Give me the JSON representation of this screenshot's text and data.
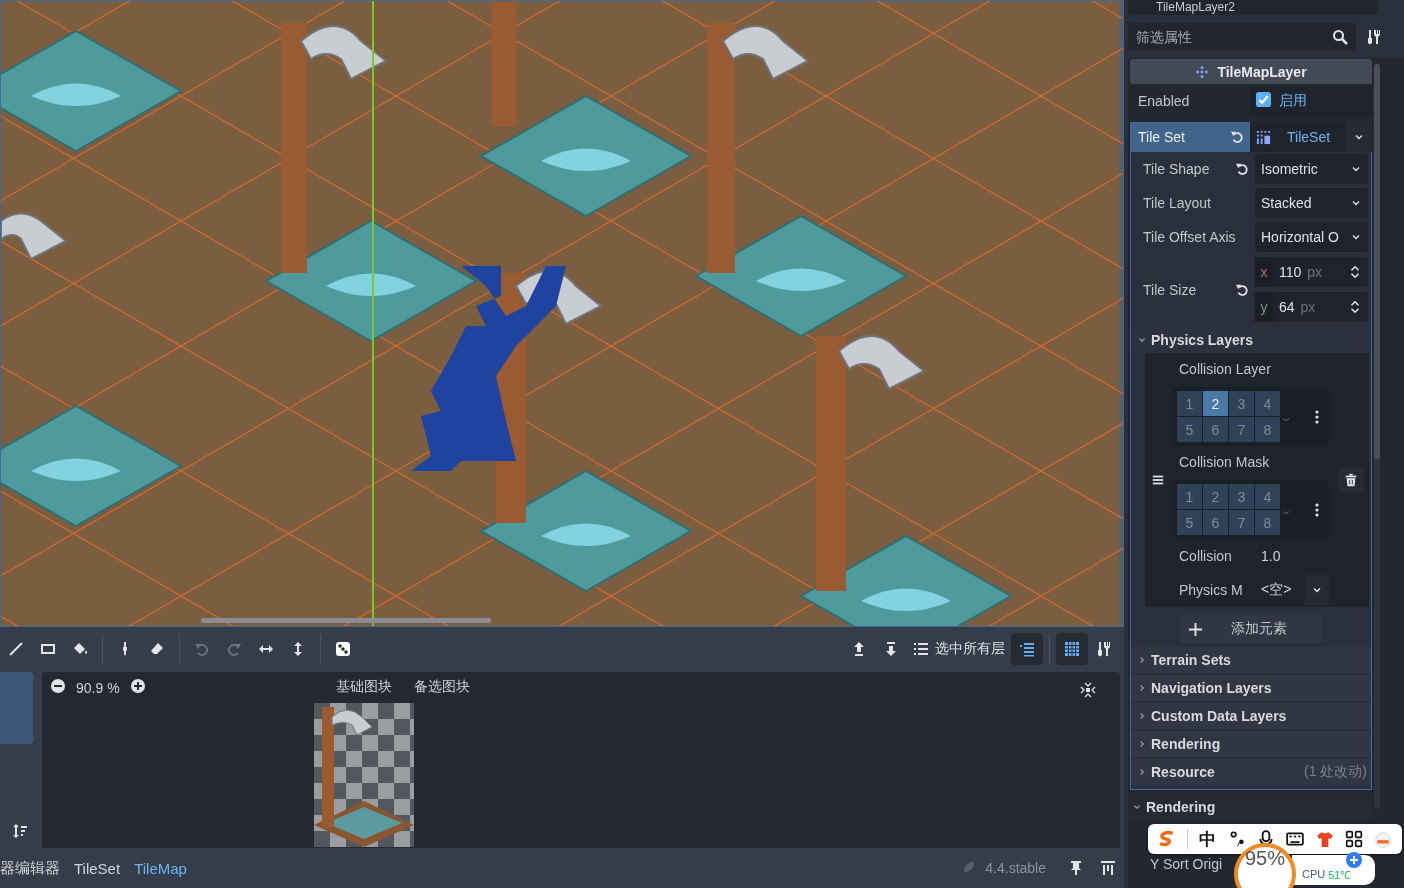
{
  "toolbar": {
    "left_tools": [
      {
        "kind": "line",
        "selected": false,
        "disabled": false
      },
      {
        "kind": "rect",
        "selected": false,
        "disabled": false
      },
      {
        "kind": "bucket",
        "selected": false,
        "disabled": false
      },
      {
        "kind": "separator"
      },
      {
        "kind": "picker",
        "selected": false,
        "disabled": false
      },
      {
        "kind": "eraser",
        "selected": false,
        "disabled": false
      },
      {
        "kind": "separator"
      },
      {
        "kind": "undo",
        "selected": false,
        "disabled": true
      },
      {
        "kind": "redo",
        "selected": false,
        "disabled": true
      },
      {
        "kind": "flip-h",
        "selected": false,
        "disabled": false
      },
      {
        "kind": "flip-v",
        "selected": false,
        "disabled": false
      },
      {
        "kind": "separator"
      },
      {
        "kind": "dice",
        "selected": false,
        "disabled": false
      }
    ],
    "right_tools": [
      {
        "kind": "up",
        "selected": false
      },
      {
        "kind": "down",
        "selected": false
      },
      {
        "kind": "select-all",
        "label": "选中所有层",
        "selected": false
      },
      {
        "kind": "highlight",
        "selected": true
      },
      {
        "kind": "separator"
      },
      {
        "kind": "grid",
        "selected": true
      },
      {
        "kind": "tools",
        "selected": false
      }
    ]
  },
  "tile_panel": {
    "zoom": "90.9 %",
    "tabs": [
      {
        "label": "基础图块"
      },
      {
        "label": "备选图块"
      }
    ]
  },
  "bottom_bar": {
    "tabs": [
      {
        "label": "器编辑器",
        "selected": false
      },
      {
        "label": "TileSet",
        "selected": false
      },
      {
        "label": "TileMap",
        "selected": true
      }
    ],
    "version": "4.4.stable"
  },
  "inspector": {
    "node": "TileMapLayer2",
    "filter_placeholder": "筛选属性",
    "class_name": "TileMapLayer",
    "enabled": {
      "label": "Enabled",
      "checked": true,
      "text": "启用"
    },
    "tile_set": {
      "label": "Tile Set",
      "value": "TileSet",
      "revertable": true
    },
    "tile_set_props": [
      {
        "kind": "dropdown",
        "label": "Tile Shape",
        "value": "Isometric",
        "revertable": true
      },
      {
        "kind": "dropdown",
        "label": "Tile Layout",
        "value": "Stacked",
        "revertable": false
      },
      {
        "kind": "dropdown",
        "label": "Tile Offset Axis",
        "value": "Horizontal O",
        "revertable": false
      },
      {
        "kind": "vector",
        "label": "Tile Size",
        "revertable": true,
        "components": [
          {
            "axis": "x",
            "value": "110",
            "unit": "px"
          },
          {
            "axis": "y",
            "value": "64",
            "unit": "px"
          }
        ]
      }
    ],
    "physics_layers": {
      "title": "Physics Layers",
      "expanded": true,
      "element": {
        "collision_layer": {
          "label": "Collision Layer",
          "bits": [
            {
              "label": "1",
              "selected": false
            },
            {
              "label": "2",
              "selected": true
            },
            {
              "label": "3",
              "selected": false
            },
            {
              "label": "4",
              "selected": false
            },
            {
              "label": "5",
              "selected": false
            },
            {
              "label": "6",
              "selected": false
            },
            {
              "label": "7",
              "selected": false
            },
            {
              "label": "8",
              "selected": false
            }
          ]
        },
        "collision_mask": {
          "label": "Collision Mask",
          "bits": [
            {
              "label": "1",
              "selected": false
            },
            {
              "label": "2",
              "selected": false
            },
            {
              "label": "3",
              "selected": false
            },
            {
              "label": "4",
              "selected": false
            },
            {
              "label": "5",
              "selected": false
            },
            {
              "label": "6",
              "selected": false
            },
            {
              "label": "7",
              "selected": false
            },
            {
              "label": "8",
              "selected": false
            }
          ]
        },
        "collision_priority": {
          "label": "Collision",
          "value": "1.0"
        },
        "physics_material": {
          "label": "Physics M",
          "value": "<空>"
        }
      },
      "add_button": "添加元素"
    },
    "sections": [
      {
        "title": "Terrain Sets",
        "expanded": false
      },
      {
        "title": "Navigation Layers",
        "expanded": false
      },
      {
        "title": "Custom Data Layers",
        "expanded": false
      },
      {
        "title": "Rendering",
        "expanded": false
      },
      {
        "title": "Resource",
        "expanded": false,
        "note": "(1 处改动)"
      }
    ],
    "rendering": {
      "title": "Rendering",
      "expanded": true
    },
    "y_sort": {
      "label": "Y Sort Origi"
    }
  },
  "ime_bar": {
    "items": [
      {
        "kind": "logo"
      },
      {
        "kind": "text",
        "text": "中"
      },
      {
        "kind": "punct"
      },
      {
        "kind": "mic"
      },
      {
        "kind": "keyboard"
      },
      {
        "kind": "shirt"
      },
      {
        "kind": "apps"
      },
      {
        "kind": "avatar"
      }
    ]
  },
  "monitor": {
    "percent": "95%",
    "cpu_label": "CPU",
    "temp": "51℃"
  }
}
